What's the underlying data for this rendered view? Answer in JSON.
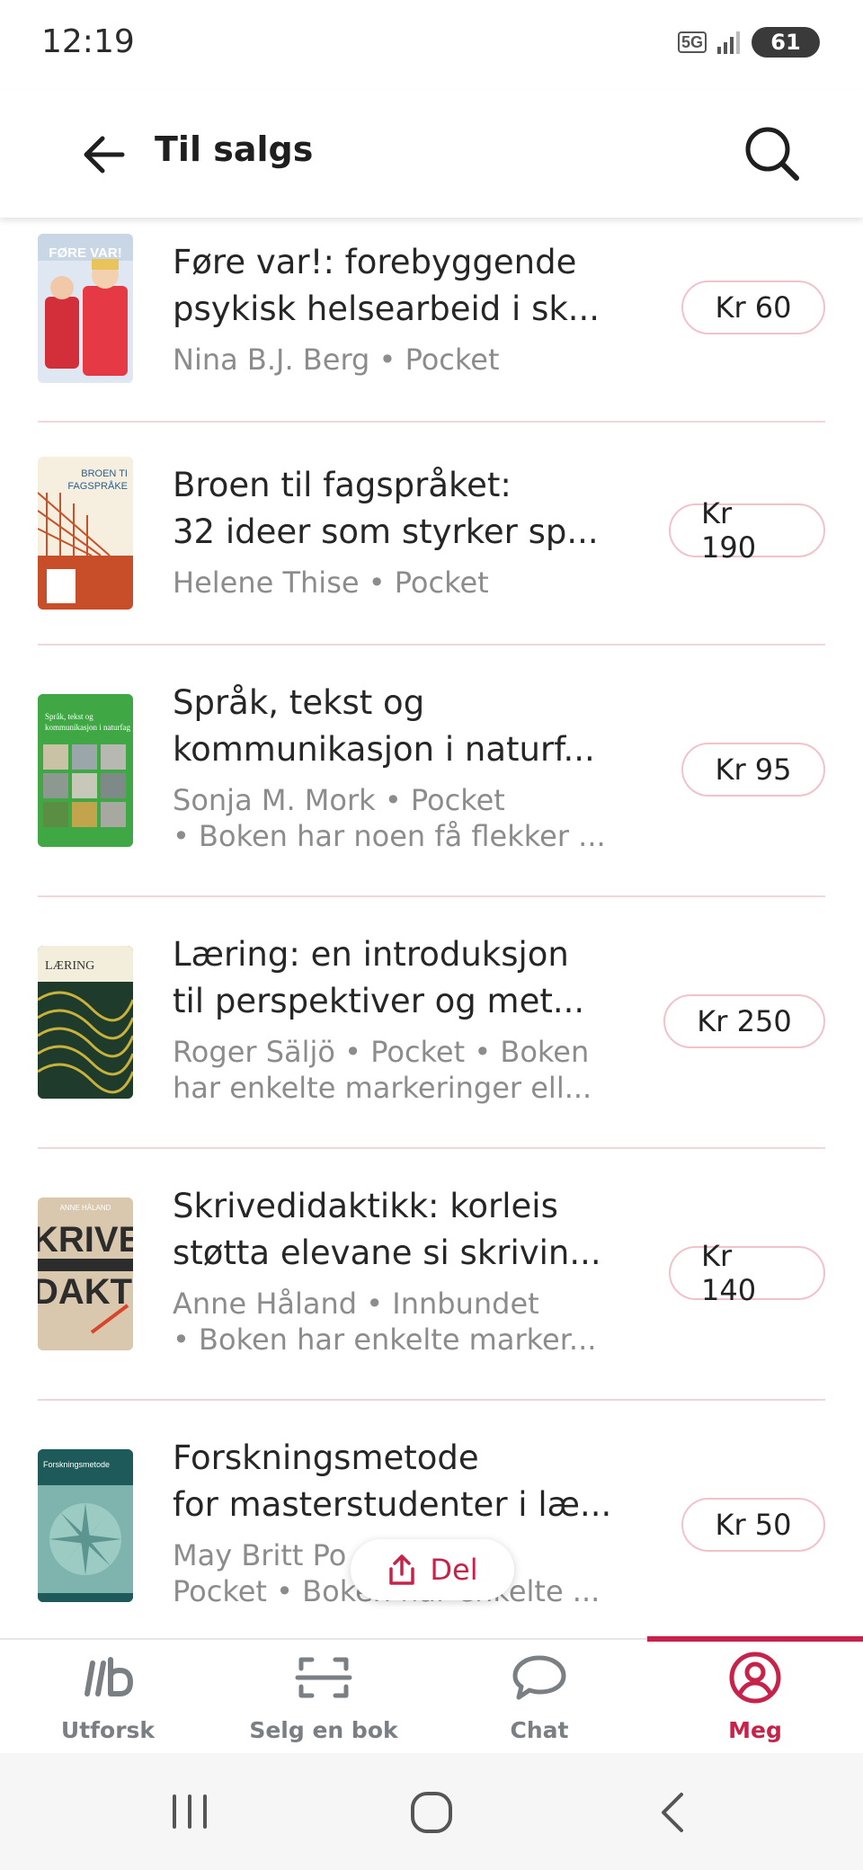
{
  "status_bar": {
    "time": "12:19",
    "network": "5G",
    "battery": "61"
  },
  "header": {
    "title": "Til salgs"
  },
  "listings": [
    {
      "title_line1": "Føre var!: forebyggende",
      "title_line2": "psykisk helsearbeid i sk...",
      "meta_line1": "Nina B.J. Berg • Pocket",
      "meta_line2": "",
      "price": "Kr 60",
      "cover_text": "FØRE VAR!"
    },
    {
      "title_line1": "Broen til fagspråket:",
      "title_line2": "32 ideer som styrker sp...",
      "meta_line1": "Helene Thise • Pocket",
      "meta_line2": "",
      "price": "Kr 190",
      "cover_text": "BROEN TI FAGSPRÅKE"
    },
    {
      "title_line1": "Språk, tekst og",
      "title_line2": "kommunikasjon i naturf...",
      "meta_line1": "Sonja M. Mork • Pocket",
      "meta_line2": "• Boken har noen få flekker ...",
      "price": "Kr 95",
      "cover_text": "Språk, tekst og kommunikasjon i naturfag"
    },
    {
      "title_line1": "Læring: en introduksjon",
      "title_line2": "til perspektiver og met...",
      "meta_line1": "Roger Säljö • Pocket • Boken",
      "meta_line2": "har enkelte markeringer ell...",
      "price": "Kr 250",
      "cover_text": "LÆRING"
    },
    {
      "title_line1": "Skrivedidaktikk: korleis",
      "title_line2": "støtta elevane si skrivin...",
      "meta_line1": "Anne Håland • Innbundet",
      "meta_line2": "• Boken har enkelte marker...",
      "price": "Kr 140",
      "cover_text": "SKRIVE DIDAKTIKK"
    },
    {
      "title_line1": "Forskningsmetode",
      "title_line2": "for masterstudenter i læ...",
      "meta_line1": "May Britt Po",
      "meta_line2": "Pocket • Boken har enkelte ...",
      "price": "Kr 50",
      "cover_text": "Forskningsmetode"
    }
  ],
  "share_button": {
    "label": "Del"
  },
  "bottom_nav": [
    {
      "label": "Utforsk",
      "icon": "logo-icon",
      "active": false
    },
    {
      "label": "Selg en bok",
      "icon": "scan-icon",
      "active": false
    },
    {
      "label": "Chat",
      "icon": "chat-bubble-icon",
      "active": false
    },
    {
      "label": "Meg",
      "icon": "profile-icon",
      "active": true
    }
  ],
  "colors": {
    "accent": "#c5234a",
    "divider": "#f0d7dc",
    "price_border": "#f2c2cc",
    "muted_text": "#8c8c8c"
  }
}
